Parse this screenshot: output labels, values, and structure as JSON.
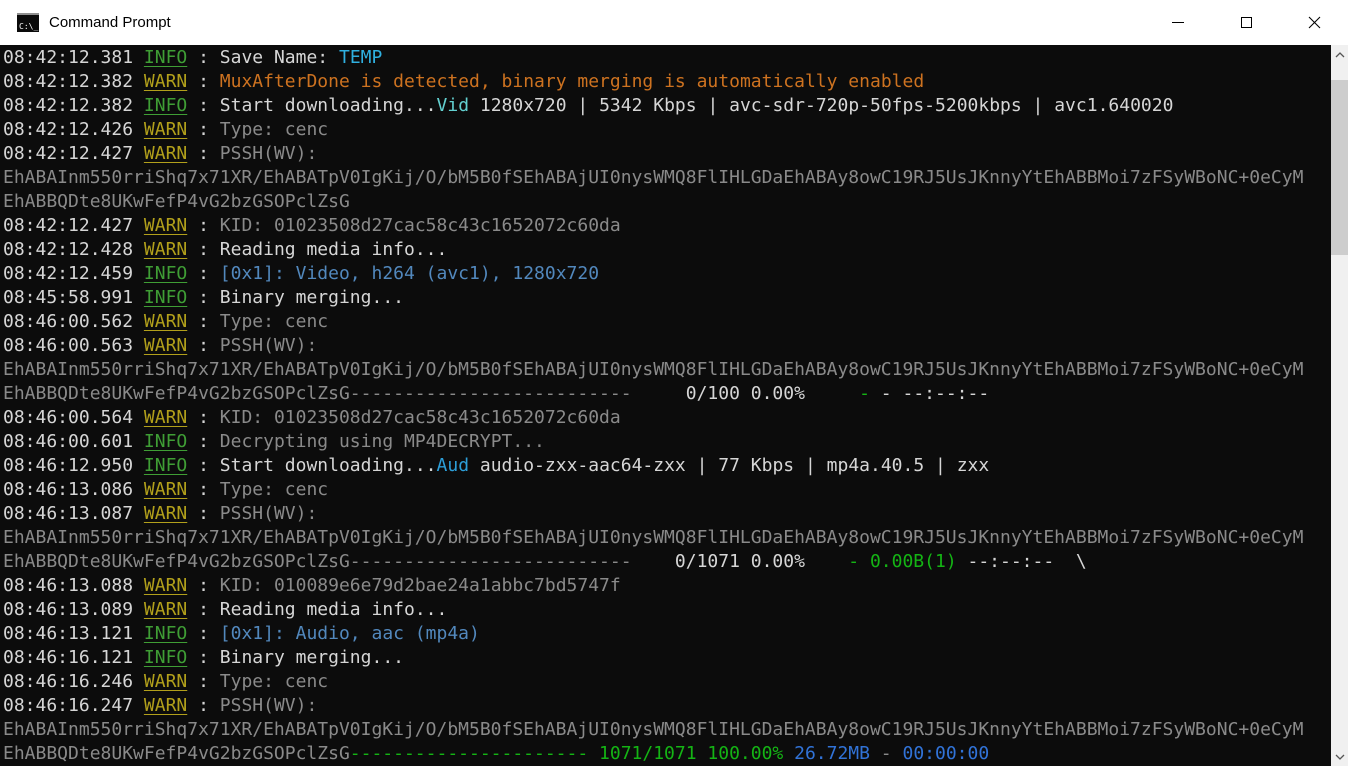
{
  "window": {
    "title": "Command Prompt"
  },
  "titlebar": {
    "icon_text": "C:\\_"
  },
  "terminal": {
    "background": "#0c0c0c",
    "palette": {
      "w": {
        "color": "#d6d6d6"
      },
      "g": {
        "color": "#8a8a8a"
      },
      "info": {
        "color": "#3f9e35",
        "underline": true
      },
      "warn": {
        "color": "#b2a01b",
        "underline": true
      },
      "orange": {
        "color": "#cd7220"
      },
      "temp": {
        "color": "#2fb0e0"
      },
      "vid": {
        "color": "#63d0d0"
      },
      "aud": {
        "color": "#2d9fd9"
      },
      "sb": {
        "color": "#5288bd"
      },
      "grn": {
        "color": "#14b414"
      },
      "blu": {
        "color": "#3173d8"
      }
    },
    "lines": [
      [
        {
          "t": "08:42:12.381 ",
          "c": "w"
        },
        {
          "t": "INFO",
          "c": "info"
        },
        {
          "t": " : ",
          "c": "w"
        },
        {
          "t": "Save Name: ",
          "c": "w"
        },
        {
          "t": "TEMP",
          "c": "temp"
        }
      ],
      [
        {
          "t": "08:42:12.382 ",
          "c": "w"
        },
        {
          "t": "WARN",
          "c": "warn"
        },
        {
          "t": " : ",
          "c": "w"
        },
        {
          "t": "MuxAfterDone is detected, binary merging is automatically enabled",
          "c": "orange"
        }
      ],
      [
        {
          "t": "08:42:12.382 ",
          "c": "w"
        },
        {
          "t": "INFO",
          "c": "info"
        },
        {
          "t": " : ",
          "c": "w"
        },
        {
          "t": "Start downloading...",
          "c": "w"
        },
        {
          "t": "Vid",
          "c": "vid"
        },
        {
          "t": " 1280x720 | 5342 Kbps | avc-sdr-720p-50fps-5200kbps | avc1.640020",
          "c": "w"
        }
      ],
      [
        {
          "t": "08:42:12.426 ",
          "c": "w"
        },
        {
          "t": "WARN",
          "c": "warn"
        },
        {
          "t": " : ",
          "c": "w"
        },
        {
          "t": "Type: cenc",
          "c": "g"
        }
      ],
      [
        {
          "t": "08:42:12.427 ",
          "c": "w"
        },
        {
          "t": "WARN",
          "c": "warn"
        },
        {
          "t": " : ",
          "c": "w"
        },
        {
          "t": "PSSH(WV):",
          "c": "g"
        }
      ],
      [
        {
          "t": "EhABAInm550rriShq7x71XR/EhABATpV0IgKij/O/bM5B0fSEhABAjUI0nysWMQ8FlIHLGDaEhABAy8owC19RJ5UsJKnnyYtEhABBMoi7zFSyWBoNC+0eCyM",
          "c": "g"
        }
      ],
      [
        {
          "t": "EhABBQDte8UKwFefP4vG2bzGSOPclZsG",
          "c": "g"
        }
      ],
      [
        {
          "t": "08:42:12.427 ",
          "c": "w"
        },
        {
          "t": "WARN",
          "c": "warn"
        },
        {
          "t": " : ",
          "c": "w"
        },
        {
          "t": "KID: 01023508d27cac58c43c1652072c60da",
          "c": "g"
        }
      ],
      [
        {
          "t": "08:42:12.428 ",
          "c": "w"
        },
        {
          "t": "WARN",
          "c": "warn"
        },
        {
          "t": " : ",
          "c": "w"
        },
        {
          "t": "Reading media info...",
          "c": "w"
        }
      ],
      [
        {
          "t": "08:42:12.459 ",
          "c": "w"
        },
        {
          "t": "INFO",
          "c": "info"
        },
        {
          "t": " : ",
          "c": "w"
        },
        {
          "t": "[0x1]: Video, h264 (avc1), 1280x720",
          "c": "sb"
        }
      ],
      [
        {
          "t": "08:45:58.991 ",
          "c": "w"
        },
        {
          "t": "INFO",
          "c": "info"
        },
        {
          "t": " : ",
          "c": "w"
        },
        {
          "t": "Binary merging...",
          "c": "w"
        }
      ],
      [
        {
          "t": "08:46:00.562 ",
          "c": "w"
        },
        {
          "t": "WARN",
          "c": "warn"
        },
        {
          "t": " : ",
          "c": "w"
        },
        {
          "t": "Type: cenc",
          "c": "g"
        }
      ],
      [
        {
          "t": "08:46:00.563 ",
          "c": "w"
        },
        {
          "t": "WARN",
          "c": "warn"
        },
        {
          "t": " : ",
          "c": "w"
        },
        {
          "t": "PSSH(WV):",
          "c": "g"
        }
      ],
      [
        {
          "t": "EhABAInm550rriShq7x71XR/EhABATpV0IgKij/O/bM5B0fSEhABAjUI0nysWMQ8FlIHLGDaEhABAy8owC19RJ5UsJKnnyYtEhABBMoi7zFSyWBoNC+0eCyM",
          "c": "g"
        }
      ],
      [
        {
          "t": "EhABBQDte8UKwFefP4vG2bzGSOPclZsG",
          "c": "g"
        },
        {
          "t": "--------------------------",
          "c": "g"
        },
        {
          "t": "     0/100 0.00%",
          "c": "w"
        },
        {
          "t": "     -",
          "c": "grn"
        },
        {
          "t": " - ",
          "c": "w"
        },
        {
          "t": "--:--:--",
          "c": "w"
        }
      ],
      [
        {
          "t": "08:46:00.564 ",
          "c": "w"
        },
        {
          "t": "WARN",
          "c": "warn"
        },
        {
          "t": " : ",
          "c": "w"
        },
        {
          "t": "KID: 01023508d27cac58c43c1652072c60da",
          "c": "g"
        }
      ],
      [
        {
          "t": "08:46:00.601 ",
          "c": "w"
        },
        {
          "t": "INFO",
          "c": "info"
        },
        {
          "t": " : ",
          "c": "w"
        },
        {
          "t": "Decrypting using MP4DECRYPT...",
          "c": "g"
        }
      ],
      [
        {
          "t": "08:46:12.950 ",
          "c": "w"
        },
        {
          "t": "INFO",
          "c": "info"
        },
        {
          "t": " : ",
          "c": "w"
        },
        {
          "t": "Start downloading...",
          "c": "w"
        },
        {
          "t": "Aud",
          "c": "aud"
        },
        {
          "t": " audio-zxx-aac64-zxx | 77 Kbps | mp4a.40.5 | zxx",
          "c": "w"
        }
      ],
      [
        {
          "t": "08:46:13.086 ",
          "c": "w"
        },
        {
          "t": "WARN",
          "c": "warn"
        },
        {
          "t": " : ",
          "c": "w"
        },
        {
          "t": "Type: cenc",
          "c": "g"
        }
      ],
      [
        {
          "t": "08:46:13.087 ",
          "c": "w"
        },
        {
          "t": "WARN",
          "c": "warn"
        },
        {
          "t": " : ",
          "c": "w"
        },
        {
          "t": "PSSH(WV):",
          "c": "g"
        }
      ],
      [
        {
          "t": "EhABAInm550rriShq7x71XR/EhABATpV0IgKij/O/bM5B0fSEhABAjUI0nysWMQ8FlIHLGDaEhABAy8owC19RJ5UsJKnnyYtEhABBMoi7zFSyWBoNC+0eCyM",
          "c": "g"
        }
      ],
      [
        {
          "t": "EhABBQDte8UKwFefP4vG2bzGSOPclZsG",
          "c": "g"
        },
        {
          "t": "--------------------------",
          "c": "g"
        },
        {
          "t": "    0/1071 0.00%",
          "c": "w"
        },
        {
          "t": "    - 0.00B(1)",
          "c": "grn"
        },
        {
          "t": " --:--:--  \\",
          "c": "w"
        }
      ],
      [
        {
          "t": "08:46:13.088 ",
          "c": "w"
        },
        {
          "t": "WARN",
          "c": "warn"
        },
        {
          "t": " : ",
          "c": "w"
        },
        {
          "t": "KID: 010089e6e79d2bae24a1abbc7bd5747f",
          "c": "g"
        }
      ],
      [
        {
          "t": "08:46:13.089 ",
          "c": "w"
        },
        {
          "t": "WARN",
          "c": "warn"
        },
        {
          "t": " : ",
          "c": "w"
        },
        {
          "t": "Reading media info...",
          "c": "w"
        }
      ],
      [
        {
          "t": "08:46:13.121 ",
          "c": "w"
        },
        {
          "t": "INFO",
          "c": "info"
        },
        {
          "t": " : ",
          "c": "w"
        },
        {
          "t": "[0x1]: Audio, aac (mp4a)",
          "c": "sb"
        }
      ],
      [
        {
          "t": "08:46:16.121 ",
          "c": "w"
        },
        {
          "t": "INFO",
          "c": "info"
        },
        {
          "t": " : ",
          "c": "w"
        },
        {
          "t": "Binary merging...",
          "c": "w"
        }
      ],
      [
        {
          "t": "08:46:16.246 ",
          "c": "w"
        },
        {
          "t": "WARN",
          "c": "warn"
        },
        {
          "t": " : ",
          "c": "w"
        },
        {
          "t": "Type: cenc",
          "c": "g"
        }
      ],
      [
        {
          "t": "08:46:16.247 ",
          "c": "w"
        },
        {
          "t": "WARN",
          "c": "warn"
        },
        {
          "t": " : ",
          "c": "w"
        },
        {
          "t": "PSSH(WV):",
          "c": "g"
        }
      ],
      [
        {
          "t": "EhABAInm550rriShq7x71XR/EhABATpV0IgKij/O/bM5B0fSEhABAjUI0nysWMQ8FlIHLGDaEhABAy8owC19RJ5UsJKnnyYtEhABBMoi7zFSyWBoNC+0eCyM",
          "c": "g"
        }
      ],
      [
        {
          "t": "EhABBQDte8UKwFefP4vG2bzGSOPclZsG",
          "c": "g"
        },
        {
          "t": "---------------------- ",
          "c": "grn"
        },
        {
          "t": "1071/1071 100.00% ",
          "c": "grn"
        },
        {
          "t": "26.72MB",
          "c": "blu"
        },
        {
          "t": " - ",
          "c": "g"
        },
        {
          "t": "00:00:00",
          "c": "blu"
        }
      ]
    ]
  }
}
